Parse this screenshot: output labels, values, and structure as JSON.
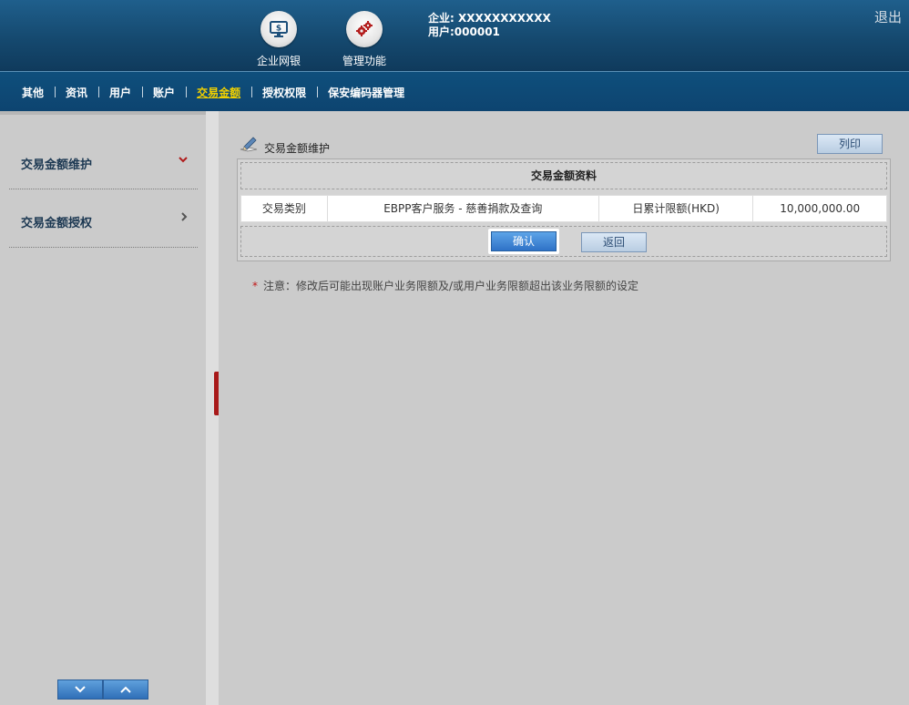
{
  "header": {
    "netbank_label": "企业网银",
    "admin_label": "管理功能",
    "company_line": "企业: XXXXXXXXXXX",
    "user_line": "用户:000001",
    "logout_label": "退出"
  },
  "nav": {
    "items": [
      "其他",
      "资讯",
      "用户",
      "账户",
      "交易金额",
      "授权权限",
      "保安编码器管理"
    ],
    "active_index": 4
  },
  "sidebar": {
    "items": [
      {
        "label": "交易金额维护"
      },
      {
        "label": "交易金额授权"
      }
    ]
  },
  "main": {
    "page_title": "交易金额维护",
    "print_label": "列印",
    "panel_title": "交易金额资料",
    "row": {
      "type_label": "交易类别",
      "type_value": "EBPP客户服务 - 慈善捐款及查询",
      "limit_label": "日累计限额(HKD)",
      "limit_value": "10,000,000.00"
    },
    "confirm_label": "确认",
    "back_label": "返回",
    "notice": "注意：修改后可能出现账户业务限额及/或用户业务限额超出该业务限额的设定"
  },
  "colors": {
    "header_bg": "#15496f",
    "nav_active": "#f0d000",
    "accent_red": "#a81919",
    "button_blue": "#2f72c7"
  }
}
